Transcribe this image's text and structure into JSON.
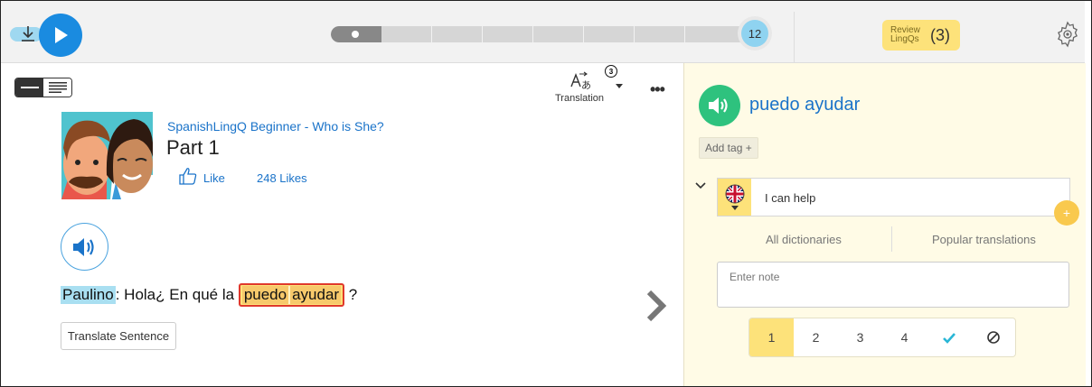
{
  "player": {
    "progress_fraction": 0.12,
    "page_number": "12"
  },
  "review": {
    "label": "Review LingQs",
    "count": "(3)"
  },
  "toolbar": {
    "translation_label": "Translation",
    "translation_count": "3",
    "more_label": "•••"
  },
  "lesson": {
    "course": "SpanishLingQ Beginner - Who is She?",
    "title": "Part 1",
    "like_label": "Like",
    "likes_count": "248 Likes"
  },
  "sentence": {
    "speaker": "Paulino",
    "colon": ":",
    "text_before": " Hola¿ En qué la ",
    "phrase_word1": "puedo",
    "phrase_word2": "ayudar",
    "text_after": " ?"
  },
  "translate_sentence_label": "Translate Sentence",
  "panel": {
    "term": "puedo ayudar",
    "add_tag": "Add tag +",
    "hint": "I can help",
    "plus": "+",
    "tab_all": "All dictionaries",
    "tab_popular": "Popular translations",
    "note_placeholder": "Enter note",
    "status": [
      "1",
      "2",
      "3",
      "4"
    ],
    "status_active_index": 0
  },
  "colors": {
    "accent_blue": "#1a8be0",
    "lingq_yellow": "#fde27a",
    "known_blue": "#a9dff1",
    "speak_green": "#2ec27e"
  },
  "icons": [
    "download-icon",
    "play-icon",
    "gear-icon",
    "view-toggle-icon",
    "translation-icon",
    "thumbs-up-icon",
    "speaker-icon",
    "chevron-right-icon",
    "uk-flag-icon",
    "chevron-down-icon",
    "check-icon",
    "ignore-icon"
  ]
}
